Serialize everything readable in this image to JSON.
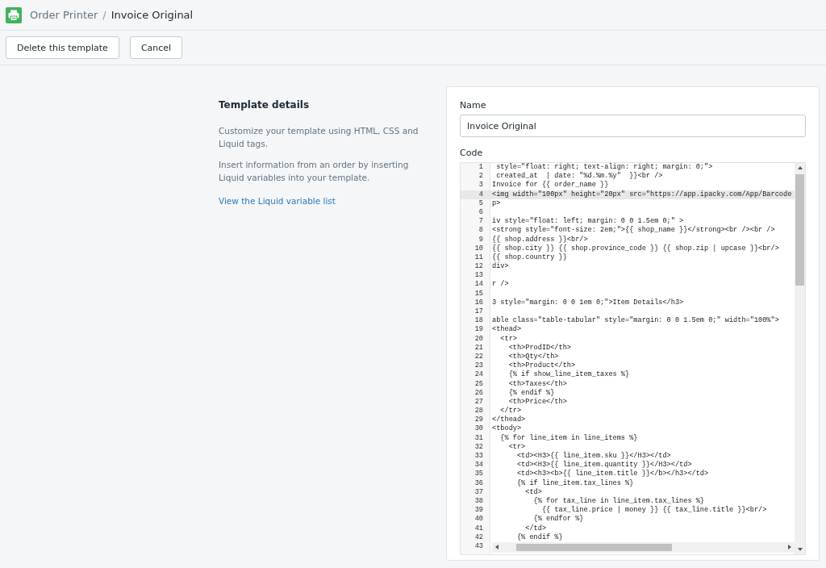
{
  "breadcrumb": {
    "app": "Order Printer",
    "separator": "/",
    "page": "Invoice Original"
  },
  "actions": [
    "Delete this template",
    "Cancel"
  ],
  "details": {
    "title": "Template details",
    "paragraphs": [
      "Customize your template using HTML, CSS and Liquid tags.",
      "Insert information from an order by inserting Liquid variables into your template."
    ],
    "link": "View the Liquid variable list"
  },
  "form": {
    "name_label": "Name",
    "name_value": "Invoice Original",
    "code_label": "Code"
  },
  "code_lines": [
    {
      "number": "1",
      "text": " style=\"float: right; text-align: right; margin: 0;\">",
      "selected": false
    },
    {
      "number": "2",
      "text": " created_at  | date: \"%d.%m.%y\"  }}<br />",
      "selected": false
    },
    {
      "number": "3",
      "text": "Invoice for {{ order_name }}",
      "selected": false
    },
    {
      "number": "4",
      "text": "<img width=\"100px\" height=\"20px\" src=\"https://app.ipacky.com/App/Barcode",
      "selected": true
    },
    {
      "number": "5",
      "text": "p>",
      "selected": false
    },
    {
      "number": "6",
      "selected": false
    },
    {
      "number": "7",
      "text": "iv style=\"float: left; margin: 0 0 1.5em 0;\" >",
      "selected": false
    },
    {
      "number": "8",
      "text": "<strong style=\"font-size: 2em;\">{{ shop_name }}</strong><br /><br />",
      "selected": false
    },
    {
      "number": "9",
      "text": "{{ shop.address }}<br/>",
      "selected": false
    },
    {
      "number": "10",
      "text": "{{ shop.city }} {{ shop.province_code }} {{ shop.zip | upcase }}<br/>",
      "selected": false
    },
    {
      "number": "11",
      "text": "{{ shop.country }}",
      "selected": false
    },
    {
      "number": "12",
      "text": "div>",
      "selected": false
    },
    {
      "number": "13",
      "selected": false
    },
    {
      "number": "14",
      "text": "r />",
      "selected": false
    },
    {
      "number": "15",
      "selected": false
    },
    {
      "number": "16",
      "text": "3 style=\"margin: 0 0 1em 0;\">Item Details</h3>",
      "selected": false
    },
    {
      "number": "17",
      "selected": false
    },
    {
      "number": "18",
      "text": "able class=\"table-tabular\" style=\"margin: 0 0 1.5em 0;\" width=\"100%\">",
      "selected": false
    },
    {
      "number": "19",
      "text": "<thead>",
      "selected": false
    },
    {
      "number": "20",
      "text": "  <tr>",
      "selected": false
    },
    {
      "number": "21",
      "text": "    <th>ProdID</th>",
      "selected": false
    },
    {
      "number": "22",
      "text": "    <th>Qty</th>",
      "selected": false
    },
    {
      "number": "23",
      "text": "    <th>Product</th>",
      "selected": false
    },
    {
      "number": "24",
      "text": "    {% if show_line_item_taxes %}",
      "selected": false
    },
    {
      "number": "25",
      "text": "    <th>Taxes</th>",
      "selected": false
    },
    {
      "number": "26",
      "text": "    {% endif %}",
      "selected": false
    },
    {
      "number": "27",
      "text": "    <th>Price</th>",
      "selected": false
    },
    {
      "number": "28",
      "text": "  </tr>",
      "selected": false
    },
    {
      "number": "29",
      "text": "</thead>",
      "selected": false
    },
    {
      "number": "30",
      "text": "<tbody>",
      "selected": false
    },
    {
      "number": "31",
      "text": "  {% for line_item in line_items %}",
      "selected": false
    },
    {
      "number": "32",
      "text": "    <tr>",
      "selected": false
    },
    {
      "number": "33",
      "text": "      <td><H3>{{ line_item.sku }}</H3></td>",
      "selected": false
    },
    {
      "number": "34",
      "text": "      <td><H3>{{ line_item.quantity }}</H3></td>",
      "selected": false
    },
    {
      "number": "35",
      "text": "      <td><h3><b>{{ line_item.title }}</b></h3></td>",
      "selected": false
    },
    {
      "number": "36",
      "text": "      {% if line_item.tax_lines %}",
      "selected": false
    },
    {
      "number": "37",
      "text": "        <td>",
      "selected": false
    },
    {
      "number": "38",
      "text": "          {% for tax_line in line_item.tax_lines %}",
      "selected": false
    },
    {
      "number": "39",
      "text": "            {{ tax_line.price | money }} {{ tax_line.title }}<br/>",
      "selected": false
    },
    {
      "number": "40",
      "text": "          {% endfor %}",
      "selected": false
    },
    {
      "number": "41",
      "text": "        </td>",
      "selected": false
    },
    {
      "number": "42",
      "text": "      {% endif %}",
      "selected": false
    }
  ],
  "hidden_line_numbers": [
    "43"
  ]
}
